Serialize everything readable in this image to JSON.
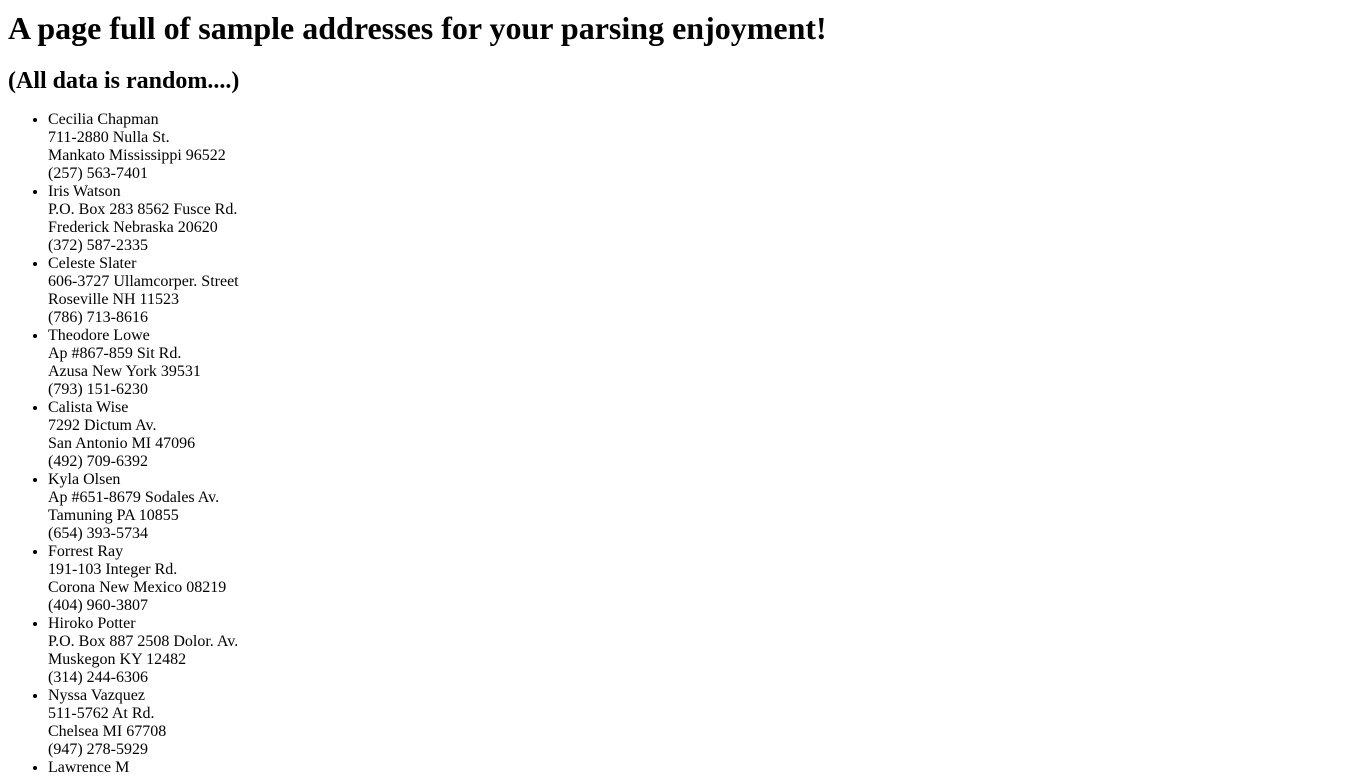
{
  "page": {
    "title": "A page full of sample addresses for your parsing enjoyment!",
    "subtitle": "(All data is random....)"
  },
  "addresses": [
    {
      "name": "Cecilia Chapman",
      "street": "711-2880 Nulla St.",
      "city_line": "Mankato Mississippi 96522",
      "phone": "(257) 563-7401"
    },
    {
      "name": "Iris Watson",
      "street": "P.O. Box 283 8562 Fusce Rd.",
      "city_line": "Frederick Nebraska 20620",
      "phone": "(372) 587-2335"
    },
    {
      "name": "Celeste Slater",
      "street": "606-3727 Ullamcorper. Street",
      "city_line": "Roseville NH 11523",
      "phone": "(786) 713-8616"
    },
    {
      "name": "Theodore Lowe",
      "street": "Ap #867-859 Sit Rd.",
      "city_line": "Azusa New York 39531",
      "phone": "(793) 151-6230"
    },
    {
      "name": "Calista Wise",
      "street": "7292 Dictum Av.",
      "city_line": "San Antonio MI 47096",
      "phone": "(492) 709-6392"
    },
    {
      "name": "Kyla Olsen",
      "street": "Ap #651-8679 Sodales Av.",
      "city_line": "Tamuning PA 10855",
      "phone": "(654) 393-5734"
    },
    {
      "name": "Forrest Ray",
      "street": "191-103 Integer Rd.",
      "city_line": "Corona New Mexico 08219",
      "phone": "(404) 960-3807"
    },
    {
      "name": "Hiroko Potter",
      "street": "P.O. Box 887 2508 Dolor. Av.",
      "city_line": "Muskegon KY 12482",
      "phone": "(314) 244-6306"
    },
    {
      "name": "Nyssa Vazquez",
      "street": "511-5762 At Rd.",
      "city_line": "Chelsea MI 67708",
      "phone": "(947) 278-5929"
    },
    {
      "name": "Lawrence M",
      "street": "",
      "city_line": "",
      "phone": ""
    }
  ]
}
